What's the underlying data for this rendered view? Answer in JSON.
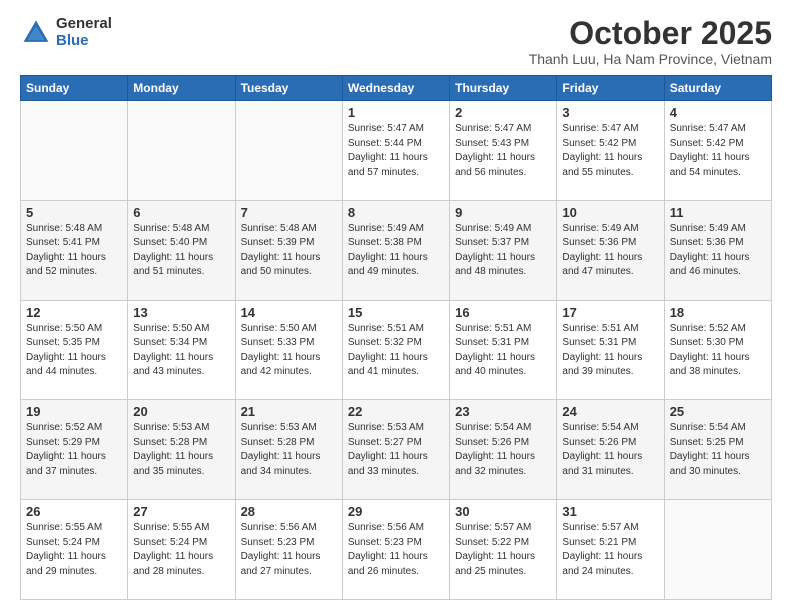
{
  "logo": {
    "general": "General",
    "blue": "Blue"
  },
  "header": {
    "month": "October 2025",
    "location": "Thanh Luu, Ha Nam Province, Vietnam"
  },
  "days_of_week": [
    "Sunday",
    "Monday",
    "Tuesday",
    "Wednesday",
    "Thursday",
    "Friday",
    "Saturday"
  ],
  "weeks": [
    [
      {
        "day": "",
        "info": ""
      },
      {
        "day": "",
        "info": ""
      },
      {
        "day": "",
        "info": ""
      },
      {
        "day": "1",
        "info": "Sunrise: 5:47 AM\nSunset: 5:44 PM\nDaylight: 11 hours\nand 57 minutes."
      },
      {
        "day": "2",
        "info": "Sunrise: 5:47 AM\nSunset: 5:43 PM\nDaylight: 11 hours\nand 56 minutes."
      },
      {
        "day": "3",
        "info": "Sunrise: 5:47 AM\nSunset: 5:42 PM\nDaylight: 11 hours\nand 55 minutes."
      },
      {
        "day": "4",
        "info": "Sunrise: 5:47 AM\nSunset: 5:42 PM\nDaylight: 11 hours\nand 54 minutes."
      }
    ],
    [
      {
        "day": "5",
        "info": "Sunrise: 5:48 AM\nSunset: 5:41 PM\nDaylight: 11 hours\nand 52 minutes."
      },
      {
        "day": "6",
        "info": "Sunrise: 5:48 AM\nSunset: 5:40 PM\nDaylight: 11 hours\nand 51 minutes."
      },
      {
        "day": "7",
        "info": "Sunrise: 5:48 AM\nSunset: 5:39 PM\nDaylight: 11 hours\nand 50 minutes."
      },
      {
        "day": "8",
        "info": "Sunrise: 5:49 AM\nSunset: 5:38 PM\nDaylight: 11 hours\nand 49 minutes."
      },
      {
        "day": "9",
        "info": "Sunrise: 5:49 AM\nSunset: 5:37 PM\nDaylight: 11 hours\nand 48 minutes."
      },
      {
        "day": "10",
        "info": "Sunrise: 5:49 AM\nSunset: 5:36 PM\nDaylight: 11 hours\nand 47 minutes."
      },
      {
        "day": "11",
        "info": "Sunrise: 5:49 AM\nSunset: 5:36 PM\nDaylight: 11 hours\nand 46 minutes."
      }
    ],
    [
      {
        "day": "12",
        "info": "Sunrise: 5:50 AM\nSunset: 5:35 PM\nDaylight: 11 hours\nand 44 minutes."
      },
      {
        "day": "13",
        "info": "Sunrise: 5:50 AM\nSunset: 5:34 PM\nDaylight: 11 hours\nand 43 minutes."
      },
      {
        "day": "14",
        "info": "Sunrise: 5:50 AM\nSunset: 5:33 PM\nDaylight: 11 hours\nand 42 minutes."
      },
      {
        "day": "15",
        "info": "Sunrise: 5:51 AM\nSunset: 5:32 PM\nDaylight: 11 hours\nand 41 minutes."
      },
      {
        "day": "16",
        "info": "Sunrise: 5:51 AM\nSunset: 5:31 PM\nDaylight: 11 hours\nand 40 minutes."
      },
      {
        "day": "17",
        "info": "Sunrise: 5:51 AM\nSunset: 5:31 PM\nDaylight: 11 hours\nand 39 minutes."
      },
      {
        "day": "18",
        "info": "Sunrise: 5:52 AM\nSunset: 5:30 PM\nDaylight: 11 hours\nand 38 minutes."
      }
    ],
    [
      {
        "day": "19",
        "info": "Sunrise: 5:52 AM\nSunset: 5:29 PM\nDaylight: 11 hours\nand 37 minutes."
      },
      {
        "day": "20",
        "info": "Sunrise: 5:53 AM\nSunset: 5:28 PM\nDaylight: 11 hours\nand 35 minutes."
      },
      {
        "day": "21",
        "info": "Sunrise: 5:53 AM\nSunset: 5:28 PM\nDaylight: 11 hours\nand 34 minutes."
      },
      {
        "day": "22",
        "info": "Sunrise: 5:53 AM\nSunset: 5:27 PM\nDaylight: 11 hours\nand 33 minutes."
      },
      {
        "day": "23",
        "info": "Sunrise: 5:54 AM\nSunset: 5:26 PM\nDaylight: 11 hours\nand 32 minutes."
      },
      {
        "day": "24",
        "info": "Sunrise: 5:54 AM\nSunset: 5:26 PM\nDaylight: 11 hours\nand 31 minutes."
      },
      {
        "day": "25",
        "info": "Sunrise: 5:54 AM\nSunset: 5:25 PM\nDaylight: 11 hours\nand 30 minutes."
      }
    ],
    [
      {
        "day": "26",
        "info": "Sunrise: 5:55 AM\nSunset: 5:24 PM\nDaylight: 11 hours\nand 29 minutes."
      },
      {
        "day": "27",
        "info": "Sunrise: 5:55 AM\nSunset: 5:24 PM\nDaylight: 11 hours\nand 28 minutes."
      },
      {
        "day": "28",
        "info": "Sunrise: 5:56 AM\nSunset: 5:23 PM\nDaylight: 11 hours\nand 27 minutes."
      },
      {
        "day": "29",
        "info": "Sunrise: 5:56 AM\nSunset: 5:23 PM\nDaylight: 11 hours\nand 26 minutes."
      },
      {
        "day": "30",
        "info": "Sunrise: 5:57 AM\nSunset: 5:22 PM\nDaylight: 11 hours\nand 25 minutes."
      },
      {
        "day": "31",
        "info": "Sunrise: 5:57 AM\nSunset: 5:21 PM\nDaylight: 11 hours\nand 24 minutes."
      },
      {
        "day": "",
        "info": ""
      }
    ]
  ]
}
